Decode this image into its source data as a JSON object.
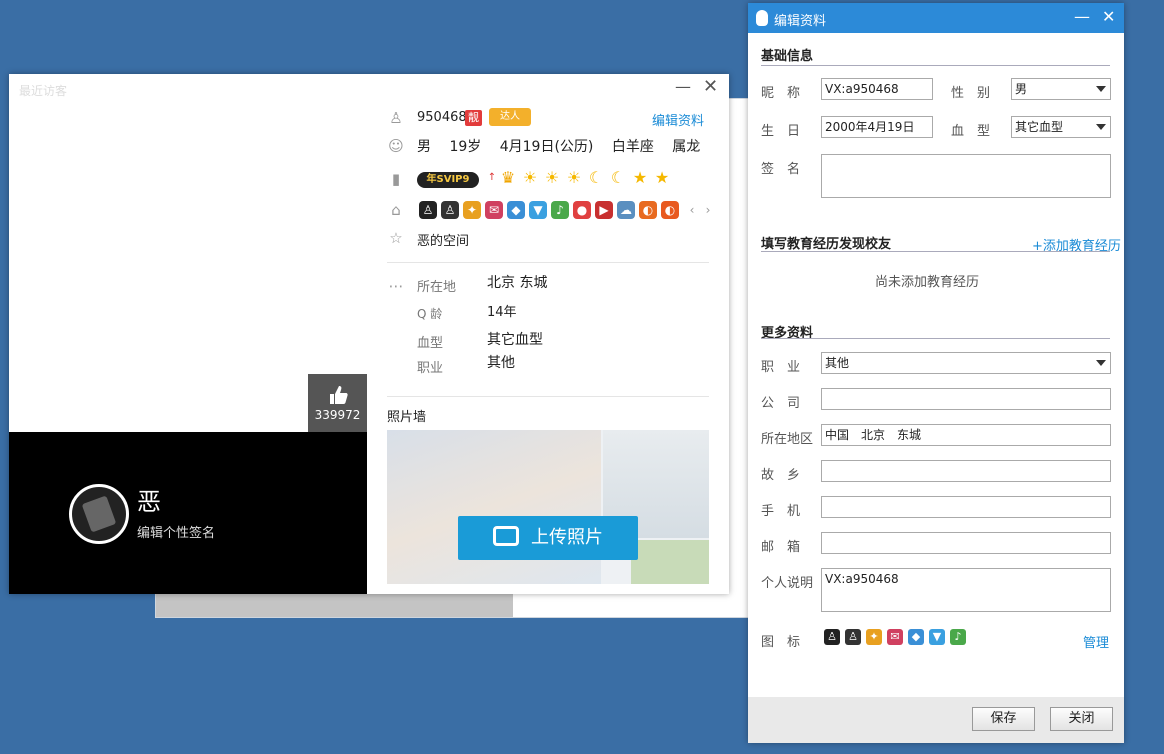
{
  "profile_card": {
    "window_title": "最近访客",
    "minimize": "—",
    "close": "✕",
    "like_count": "339972",
    "nickname": "恶",
    "signature_link": "编辑个性签名",
    "qq_number": "950468",
    "liang_badge": "靓",
    "daren_badge": "达人",
    "edit_link": "编辑资料",
    "gender": "男",
    "age": "19岁",
    "birthday": "4月19日(公历)",
    "constellation": "白羊座",
    "zodiac": "属龙",
    "vip_badge": "年SVIP9",
    "space_link": "恶的空间",
    "fields": [
      {
        "label": "所在地",
        "value": "北京 东城"
      },
      {
        "label": "Q  龄",
        "value": "14年"
      },
      {
        "label": "血型",
        "value": "其它血型"
      },
      {
        "label": "职业",
        "value": "其他"
      }
    ],
    "photo_wall_title": "照片墙",
    "upload_button": "上传照片"
  },
  "edit_dialog": {
    "title": "编辑资料",
    "minimize": "—",
    "close": "✕",
    "section_basic": "基础信息",
    "nickname_label": "昵　称",
    "nickname_value": "VX:a950468",
    "gender_label": "性　别",
    "gender_value": "男",
    "birthday_label": "生　日",
    "birthday_value": "2000年4月19日",
    "blood_label": "血　型",
    "blood_value": "其它血型",
    "signature_label": "签　名",
    "signature_value": "",
    "section_edu": "填写教育经历发现校友",
    "add_edu_link": "+添加教育经历",
    "no_edu_text": "尚未添加教育经历",
    "section_more": "更多资料",
    "job_label": "职　业",
    "job_value": "其他",
    "company_label": "公　司",
    "company_value": "",
    "location_label": "所在地区",
    "location_value": "中国　北京　东城",
    "hometown_label": "故　乡",
    "hometown_value": "",
    "phone_label": "手　机",
    "phone_value": "",
    "email_label": "邮　箱",
    "email_value": "",
    "intro_label": "个人说明",
    "intro_value": "VX:a950468",
    "icons_label": "图　标",
    "manage_link": "管理",
    "save_button": "保存",
    "close_button": "关闭"
  },
  "colors": {
    "desktop": "#3a6ea5",
    "titlebar": "#2c8ad8",
    "link": "#1a8bd6",
    "upload_btn": "#1a9bd7"
  }
}
